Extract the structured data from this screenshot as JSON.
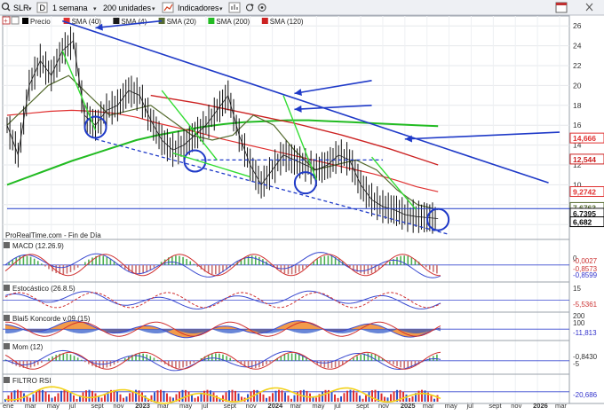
{
  "toolbar": {
    "symbol": "SLR",
    "drawing_mode": "D",
    "interval": "1 semana",
    "units": "200 unidades",
    "indicators_label": "Indicadores",
    "icons": [
      "search-icon",
      "grid-icon",
      "chevron-down-icon",
      "draw-icon",
      "indicators-icon",
      "refresh-icon",
      "settings-icon",
      "calendar-icon"
    ]
  },
  "legend": {
    "items": [
      {
        "label": "Precio",
        "color": "#000000"
      },
      {
        "label": "SMA (40)",
        "color": "#e03030"
      },
      {
        "label": "SMA (4)",
        "color": "#1a1a1a"
      },
      {
        "label": "SMA (20)",
        "color": "#556b2f"
      },
      {
        "label": "SMA (200)",
        "color": "#22bb22"
      },
      {
        "label": "SMA (120)",
        "color": "#cc2222"
      }
    ]
  },
  "source_note": "ProRealTime.com - Fin de Día",
  "panels": {
    "macd": {
      "label": "MACD (12.26.9)",
      "values": [
        "-0,0027",
        "-0,8573",
        "-0,8599"
      ]
    },
    "stoch": {
      "label": "Estocástico (26.8.5)",
      "values": [
        "15",
        "-5,5361"
      ]
    },
    "blai5": {
      "label": "Blai5 Koncorde v.09 (15)",
      "values": [
        "200",
        "100",
        "-11,813"
      ]
    },
    "mom": {
      "label": "Mom (12)",
      "values": [
        "-0,8430",
        "-5"
      ]
    },
    "filtro": {
      "label": "FILTRO RSI",
      "values": [
        "-20,686"
      ]
    }
  },
  "chart_data": {
    "type": "line",
    "title": "",
    "x_ticks": [
      "ene",
      "mar",
      "may",
      "jul",
      "sept",
      "nov",
      "2023",
      "mar",
      "may",
      "jul",
      "sept",
      "nov",
      "2024",
      "mar",
      "may",
      "jul",
      "sept",
      "nov",
      "2025",
      "mar",
      "may",
      "jul",
      "sept",
      "nov",
      "2026",
      "mar"
    ],
    "y_ticks": [
      6,
      8,
      10,
      12,
      14,
      16,
      18,
      20,
      22,
      24,
      26
    ],
    "ylim": [
      4.5,
      27
    ],
    "price_series": {
      "name": "Precio",
      "dates": [
        "2022-01",
        "2022-02",
        "2022-03",
        "2022-04",
        "2022-05",
        "2022-06",
        "2022-07",
        "2022-08",
        "2022-09",
        "2022-10",
        "2022-11",
        "2022-12",
        "2023-01",
        "2023-02",
        "2023-03",
        "2023-04",
        "2023-05",
        "2023-06",
        "2023-07",
        "2023-08",
        "2023-09",
        "2023-10",
        "2023-11",
        "2023-12",
        "2024-01",
        "2024-02",
        "2024-03",
        "2024-04",
        "2024-05",
        "2024-06",
        "2024-07",
        "2024-08",
        "2024-09",
        "2024-10",
        "2024-11",
        "2024-12",
        "2025-01",
        "2025-02",
        "2025-03",
        "2025-04"
      ],
      "values": [
        16,
        13,
        20,
        22.5,
        21,
        23.5,
        24.5,
        17,
        16,
        17.5,
        18,
        19.5,
        19,
        16.5,
        14.5,
        13.5,
        14,
        15,
        16,
        17.5,
        19,
        15,
        12,
        10,
        11.5,
        13,
        12.5,
        12,
        11.5,
        12,
        13,
        12.5,
        10,
        8.5,
        7.8,
        7.5,
        7,
        6.8,
        6.7,
        6.6
      ]
    },
    "sma_200": {
      "name": "SMA (200)",
      "values": [
        10,
        10.8,
        11.6,
        12.4,
        13.1,
        13.8,
        14.5,
        15,
        15.4,
        15.8,
        16.1,
        16.3,
        16.4,
        16.5,
        16.5,
        16.4,
        16.3,
        16.2,
        16.1,
        16.0,
        15.9
      ]
    },
    "sma_120": {
      "name": "SMA (120)",
      "values": [
        19,
        18.6,
        18.2,
        17.7,
        17.2,
        16.7,
        16.2,
        15.6,
        15.0,
        14.3,
        13.6,
        12.8,
        12.0
      ]
    },
    "sma_40": {
      "name": "SMA (40)",
      "values": [
        17,
        17.2,
        17.4,
        17.5,
        17.4,
        17.2,
        16.8,
        16.2,
        15.7,
        15.2,
        14.6,
        14.1,
        13.6,
        13.1,
        12.6,
        12.1,
        11.6,
        11.1,
        10.5,
        9.8,
        9.3
      ]
    },
    "sma_20": {
      "name": "SMA (20)",
      "values": [
        16,
        18,
        20,
        21,
        19,
        17,
        17.5,
        18,
        16.5,
        15,
        14.5,
        15,
        17,
        16,
        13.5,
        11.5,
        12,
        12.5,
        11.5,
        9.5,
        8,
        7.5
      ]
    },
    "price_labels": [
      {
        "value": 14.666,
        "text": "14,666",
        "color": "#e03030"
      },
      {
        "value": 12.544,
        "text": "12,544",
        "color": "#cc2222"
      },
      {
        "value": 9.2742,
        "text": "9,2742",
        "color": "#e03030"
      },
      {
        "value": 7.6763,
        "text": "7,6763",
        "color": "#556b2f"
      },
      {
        "value": 6.7395,
        "text": "6,7395",
        "color": "#1a1a1a"
      },
      {
        "value": 6.682,
        "text": "6,682",
        "color": "#000000"
      }
    ],
    "annotations": {
      "blue_trendline": [
        [
          "2022-06",
          26.5
        ],
        [
          "2026-02",
          10.2
        ]
      ],
      "dashed_trend": [
        [
          "2022-09",
          14.6
        ],
        [
          "2025-05",
          5.0
        ]
      ],
      "dashed_resistance": [
        [
          "2023-06",
          12.5
        ],
        [
          "2024-11",
          12.5
        ]
      ],
      "horizontal_level": [
        [
          "2022-01",
          7.6
        ],
        [
          "2026-04",
          7.6
        ]
      ],
      "circles": [
        [
          "2022-09",
          15.8
        ],
        [
          "2023-06",
          12.4
        ],
        [
          "2024-04",
          10.2
        ],
        [
          "2025-04",
          6.5
        ]
      ],
      "arrows_to": [
        [
          "2022-09",
          25.8
        ],
        [
          "2024-03",
          19.2
        ],
        [
          "2024-03",
          17.6
        ],
        [
          "2025-01",
          14.6
        ]
      ]
    }
  }
}
